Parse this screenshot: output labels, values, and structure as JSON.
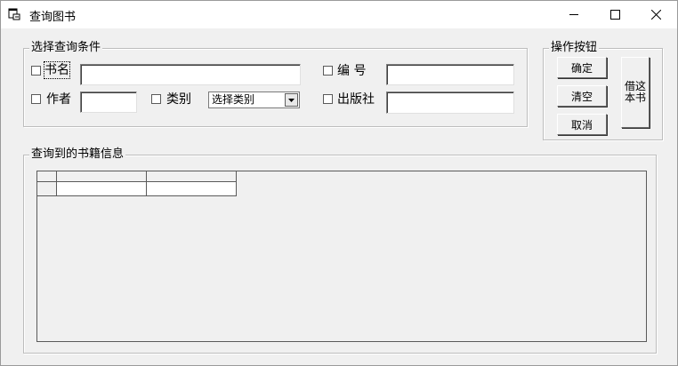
{
  "window": {
    "title": "查询图书"
  },
  "criteria": {
    "group_title": "选择查询条件",
    "book_name": {
      "label": "书名",
      "value": ""
    },
    "book_number": {
      "label": "编 号",
      "value": ""
    },
    "author": {
      "label": "作者",
      "value": ""
    },
    "category": {
      "label": "类别",
      "selected": "选择类别"
    },
    "publisher": {
      "label": "出版社",
      "value": ""
    }
  },
  "actions": {
    "group_title": "操作按钮",
    "confirm": "确定",
    "clear": "清空",
    "cancel": "取消",
    "borrow_line1": "借这",
    "borrow_line2": "本书"
  },
  "results": {
    "group_title": "查询到的书籍信息",
    "rows": [
      [
        "",
        ""
      ]
    ]
  },
  "icons": {
    "minimize": "minimize-icon",
    "maximize": "maximize-icon",
    "close": "close-icon",
    "dropdown": "dropdown-arrow-icon"
  }
}
